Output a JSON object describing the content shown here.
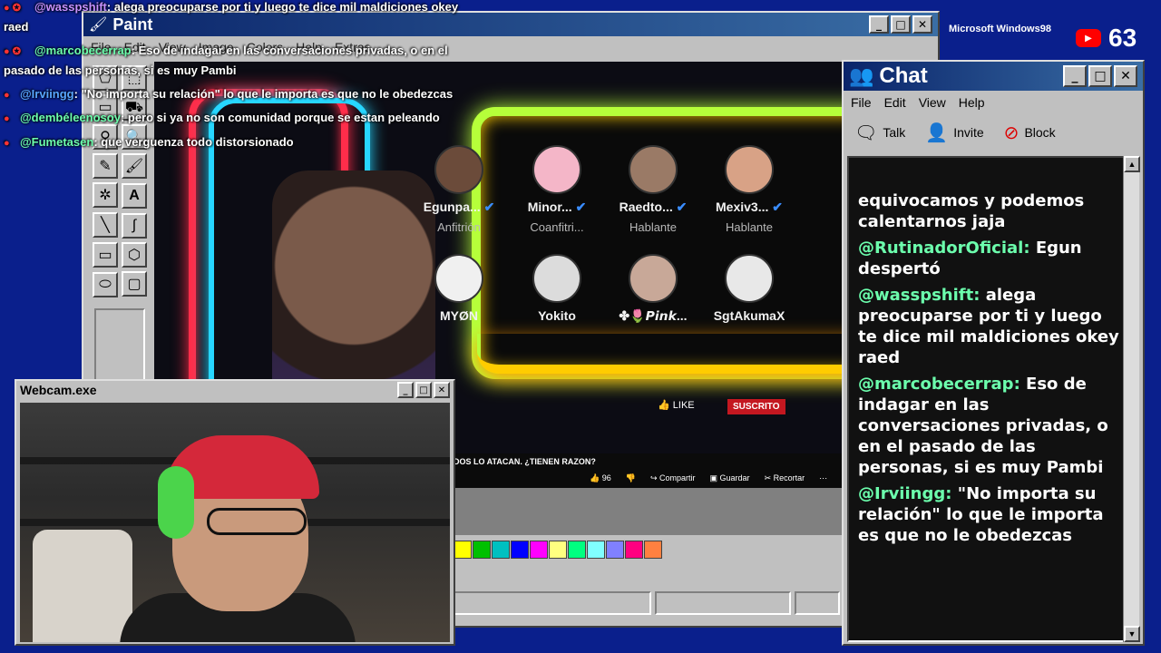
{
  "paint": {
    "title": "Paint",
    "menu": [
      "File",
      "Edit",
      "View",
      "Image",
      "Colors",
      "Help",
      "Extras"
    ],
    "palette": [
      "#ffff00",
      "#00c000",
      "#00c0c0",
      "#0000ff",
      "#ff00ff",
      "#ffff80",
      "#00ff80",
      "#80ffff",
      "#8080ff",
      "#ff0080",
      "#ff8040"
    ]
  },
  "stream": {
    "speakers": [
      {
        "name": "Egunpa...",
        "role": "Anfitrión",
        "verified": true,
        "avatar_color": "#6b4b3a"
      },
      {
        "name": "Minor...",
        "role": "Coanfitri...",
        "verified": true,
        "avatar_color": "#f4b6c8"
      },
      {
        "name": "Raedto...",
        "role": "Hablante",
        "verified": true,
        "avatar_color": "#9a7a66"
      },
      {
        "name": "Mexiv3...",
        "role": "Hablante",
        "verified": true,
        "avatar_color": "#d8a286"
      },
      {
        "name": "MYØN",
        "role": "",
        "verified": false,
        "avatar_color": "#f0f0f0"
      },
      {
        "name": "Yokito",
        "role": "",
        "verified": false,
        "avatar_color": "#dcdcdc"
      },
      {
        "name": "✤🌷𝙋𝙞𝙣𝙠...",
        "role": "",
        "verified": false,
        "avatar_color": "#c8a898"
      },
      {
        "name": "SgtAkumaX",
        "role": "",
        "verified": false,
        "avatar_color": "#e8e8e8"
      }
    ],
    "video_title": "DOS LO ATACAN. ¿TIENEN RAZON?",
    "like_label": "LIKE",
    "subscribe_label": "SUSCRITO",
    "likes": "96",
    "share_label": "Compartir",
    "save_label": "Guardar",
    "clip_label": "Recortar"
  },
  "overlay_chat": [
    {
      "user": "@wasspshift",
      "text": ": alega preocuparse por ti y luego te dice mil maldiciones okey",
      "color": "purple"
    },
    {
      "user": "",
      "text": "raed",
      "color": ""
    },
    {
      "user": "@marcobecerrap",
      "text": ": Eso de indagar en las conversaciones privadas, o en el",
      "color": "green"
    },
    {
      "user": "",
      "text": "pasado de las personas, si es muy Pambi",
      "color": ""
    },
    {
      "user": "@Irviingg",
      "text": ": \"No importa su relación\" lo que le importa es que no le obedezcas",
      "color": "blue"
    },
    {
      "user": "@dembéleenosoy",
      "text": ": pero si ya no son comunidad porque se estan peleando",
      "color": "green"
    },
    {
      "user": "@Fumetasen",
      "text": ": que verguenza todo distorsionado",
      "color": "green"
    }
  ],
  "webcam": {
    "title": "Webcam.exe"
  },
  "chat": {
    "title": "Chat",
    "menu": [
      "File",
      "Edit",
      "View",
      "Help"
    ],
    "toolbar": [
      "Talk",
      "Invite",
      "Block"
    ],
    "messages": [
      {
        "user": "",
        "text": "equivocamos y podemos calentarnos jaja"
      },
      {
        "user": "@RutinadorOficial:",
        "text": " Egun despertó"
      },
      {
        "user": "@wasspshift:",
        "text": " alega preocuparse por ti y luego te dice mil maldiciones okey raed"
      },
      {
        "user": "@marcobecerrap:",
        "text": " Eso de indagar en las conversaciones privadas, o en el pasado de las personas, si es muy Pambi"
      },
      {
        "user": "@Irviingg:",
        "text": " \"No importa su relación\" lo que le importa es que no le obedezcas"
      }
    ]
  },
  "badges": {
    "viewer_count": "63",
    "ms_text": "Microsoft Windows98"
  }
}
